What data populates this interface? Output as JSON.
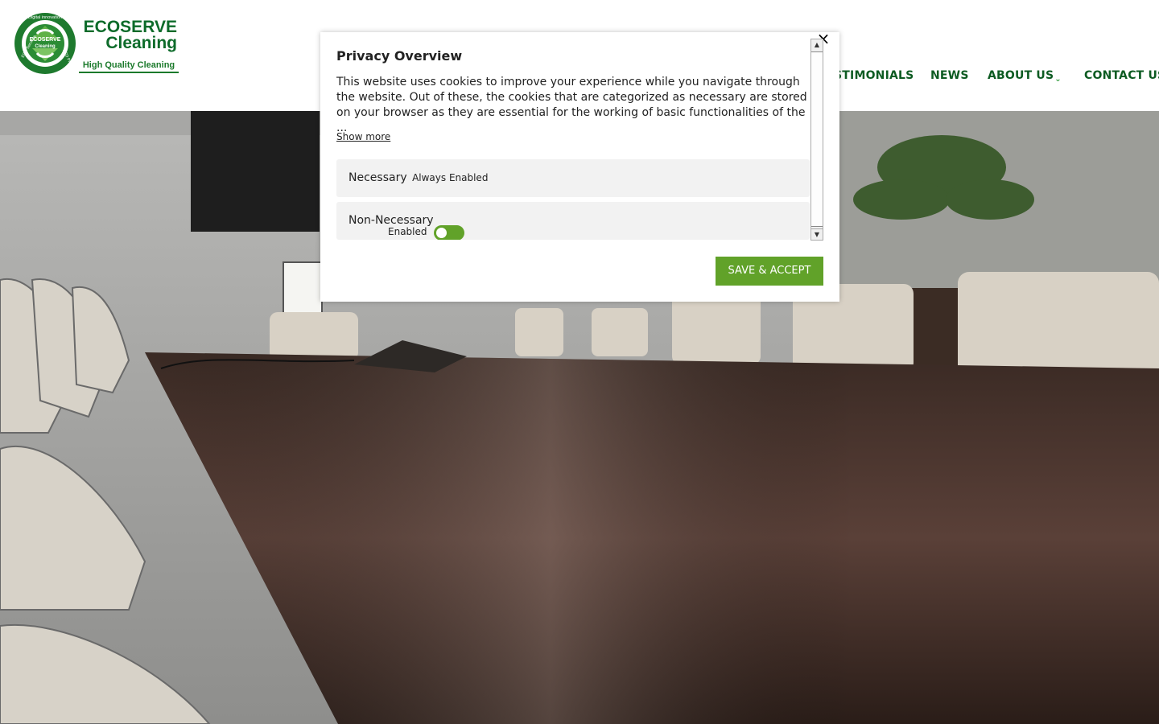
{
  "brand": {
    "title_line1": "ECOSERVE",
    "title_line2": "Cleaning",
    "tagline": "High Quality Cleaning",
    "emblem_top_text": "Digital innovation",
    "emblem_left_text": "ECO Services",
    "emblem_right_text": "ECO Products",
    "emblem_center_line1": "ECOSERVE",
    "emblem_center_line2": "Cleaning",
    "colors": {
      "primary": "#0d6b2a",
      "accent": "#61a229"
    }
  },
  "nav": {
    "items": [
      {
        "label": "STIMONIALS",
        "has_dropdown": false
      },
      {
        "label": "NEWS",
        "has_dropdown": false
      },
      {
        "label": "ABOUT US",
        "has_dropdown": true
      },
      {
        "label": "CONTACT US",
        "has_dropdown": true
      }
    ],
    "dropdown_icon": "chevron-down-icon"
  },
  "modal": {
    "title": "Privacy Overview",
    "body": "This website uses cookies to improve your experience while you navigate through the website. Out of these, the cookies that are categorized as necessary are stored on your browser as they are essential for the working of basic functionalities of the ...",
    "show_more": "Show more",
    "close_icon": "×",
    "categories": [
      {
        "name": "Necessary",
        "badge": "Always Enabled"
      },
      {
        "name": "Non-Necessary",
        "toggle_label": "Enabled",
        "toggle_on": true
      }
    ],
    "save_button": "SAVE & ACCEPT",
    "scroll_up_icon": "▲",
    "scroll_down_icon": "▼"
  }
}
